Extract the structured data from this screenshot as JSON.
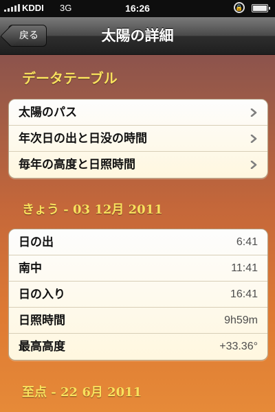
{
  "status_bar": {
    "carrier": "KDDI",
    "network": "3G",
    "time": "16:26",
    "icons": [
      "signal-icon",
      "rotation-lock-icon",
      "battery-icon"
    ]
  },
  "nav": {
    "back_label": "戻る",
    "title": "太陽の詳細"
  },
  "sections": {
    "data_table": {
      "header": "データテーブル",
      "rows": [
        {
          "label": "太陽のパス"
        },
        {
          "label": "年次日の出と日没の時間"
        },
        {
          "label": "毎年の高度と日照時間"
        }
      ]
    },
    "today": {
      "header": "きょう - 03 12月 2011",
      "rows": [
        {
          "label": "日の出",
          "value": "6:41"
        },
        {
          "label": "南中",
          "value": "11:41"
        },
        {
          "label": "日の入り",
          "value": "16:41"
        },
        {
          "label": "日照時間",
          "value": "9h59m"
        },
        {
          "label": "最高高度",
          "value": "+33.36°"
        }
      ]
    },
    "solstice": {
      "header": "至点 - 22 6月 2011"
    }
  },
  "colors": {
    "section_header": "#f9e15d",
    "chevron": "#7f7f7f",
    "value_text": "#4d4d4d"
  }
}
